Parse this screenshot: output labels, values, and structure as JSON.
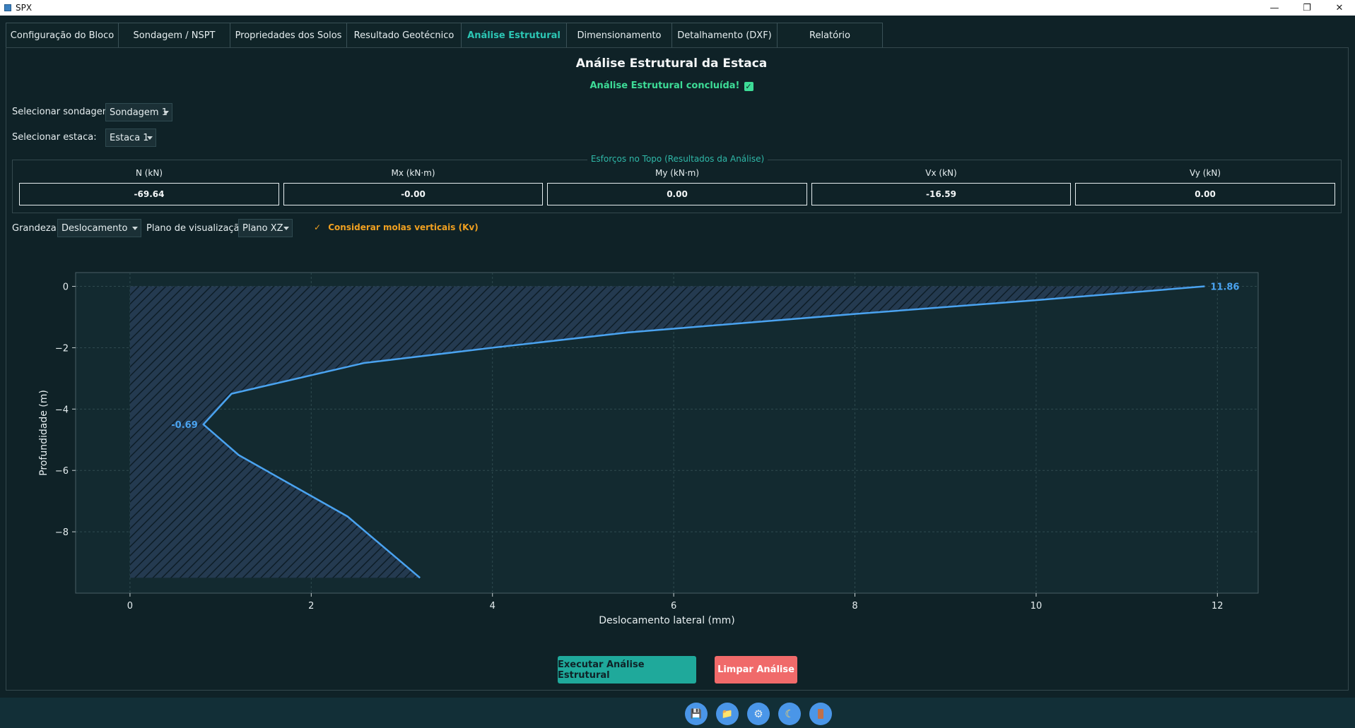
{
  "window": {
    "title": "SPX",
    "minimize": "—",
    "restore": "❐",
    "close": "✕"
  },
  "tabs": [
    {
      "label": "Configuração do Bloco",
      "active": false
    },
    {
      "label": "Sondagem / NSPT",
      "active": false
    },
    {
      "label": "Propriedades dos Solos",
      "active": false
    },
    {
      "label": "Resultado Geotécnico",
      "active": false
    },
    {
      "label": "Análise Estrutural",
      "active": true
    },
    {
      "label": "Dimensionamento",
      "active": false
    },
    {
      "label": "Detalhamento (DXF)",
      "active": false
    },
    {
      "label": "Relatório",
      "active": false
    }
  ],
  "page": {
    "title": "Análise Estrutural da Estaca",
    "status": "Análise Estrutural concluída!",
    "status_icon": "✓"
  },
  "selectors": {
    "sondagem_label": "Selecionar sondagem:",
    "sondagem_value": "Sondagem 1",
    "estaca_label": "Selecionar estaca:",
    "estaca_value": "Estaca 1"
  },
  "efforts": {
    "title": "Esforços no Topo (Resultados da Análise)",
    "columns": [
      {
        "label": "N (kN)",
        "value": "-69.64"
      },
      {
        "label": "Mx (kN·m)",
        "value": "-0.00"
      },
      {
        "label": "My (kN·m)",
        "value": "0.00"
      },
      {
        "label": "Vx (kN)",
        "value": "-16.59"
      },
      {
        "label": "Vy (kN)",
        "value": "0.00"
      }
    ]
  },
  "options": {
    "grandeza_label": "Grandeza:",
    "grandeza_value": "Deslocamento",
    "plano_label": "Plano de visualização:",
    "plano_value": "Plano XZ",
    "kv_check": "✓",
    "kv_label": "Considerar molas verticais (Kv)"
  },
  "colors": {
    "accent": "#2cc6b4",
    "success": "#3ddc97",
    "line": "#4aa3f0",
    "warning": "#f0a020",
    "danger": "#f06a6a",
    "background": "#0f2227"
  },
  "chart_data": {
    "type": "line",
    "title": "",
    "xlabel": "Deslocamento lateral (mm)",
    "ylabel": "Profundidade (m)",
    "xlim": [
      -0.6,
      12.45
    ],
    "ylim": [
      -10.0,
      0.45
    ],
    "xticks": [
      0,
      2,
      4,
      6,
      8,
      10,
      12
    ],
    "yticks": [
      0,
      -2,
      -4,
      -6,
      -8
    ],
    "grid": true,
    "fill": "hatched area between curve and x = 0",
    "series": [
      {
        "x": [
          11.86,
          10.0,
          8.0,
          5.5,
          4.0,
          2.58,
          1.12,
          0.81,
          1.2,
          2.4,
          2.8,
          3.2
        ],
        "y": [
          0.0,
          -0.45,
          -0.9,
          -1.5,
          -2.0,
          -2.5,
          -3.5,
          -4.5,
          -5.5,
          -7.5,
          -8.5,
          -9.5
        ]
      }
    ],
    "annotations": [
      {
        "text": "11.86",
        "x": 11.86,
        "y": 0.0
      },
      {
        "text": "-0.69",
        "x": 0.81,
        "y": -4.5
      }
    ]
  },
  "buttons": {
    "run": "Executar Análise Estrutural",
    "clear": "Limpar Análise"
  },
  "bottom_toolbar": [
    {
      "name": "save-icon",
      "glyph": "💾"
    },
    {
      "name": "folder-icon",
      "glyph": "📁"
    },
    {
      "name": "gear-icon",
      "glyph": "⚙"
    },
    {
      "name": "moon-icon",
      "glyph": "☾"
    },
    {
      "name": "exit-icon",
      "glyph": "🚪"
    }
  ]
}
